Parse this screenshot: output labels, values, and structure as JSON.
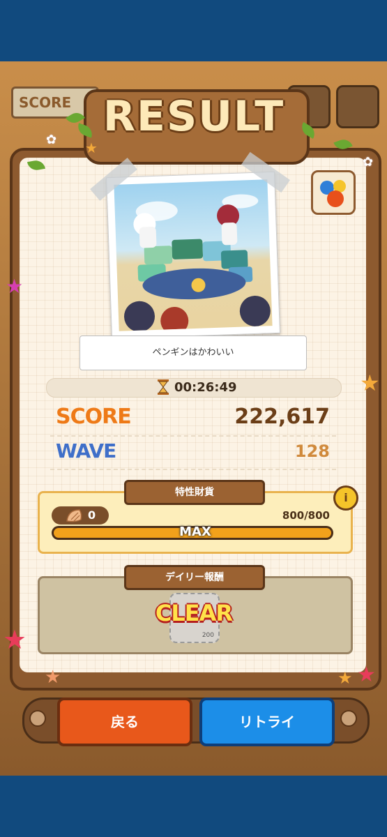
{
  "header": {
    "title": "RESULT",
    "bg_score_label": "SCORE"
  },
  "photo": {
    "caption": "ペンギンはかわいい"
  },
  "time": {
    "value": "00:26:49"
  },
  "stats": {
    "score_label": "SCORE",
    "score_value": "222,617",
    "wave_label": "WAVE",
    "wave_value": "128"
  },
  "trait": {
    "header": "特性財貨",
    "currency_count": "0",
    "progress_text": "800/800",
    "progress_fraction": 1.0,
    "bar_label": "MAX",
    "info_label": "i"
  },
  "daily": {
    "header": "デイリー報酬",
    "status": "CLEAR",
    "chip_amount": "200"
  },
  "buttons": {
    "back": "戻る",
    "retry": "リトライ"
  },
  "colors": {
    "score": "#ee7a17",
    "wave": "#3f6fc9",
    "back_button": "#e8581b",
    "retry_button": "#1c8ee8"
  }
}
